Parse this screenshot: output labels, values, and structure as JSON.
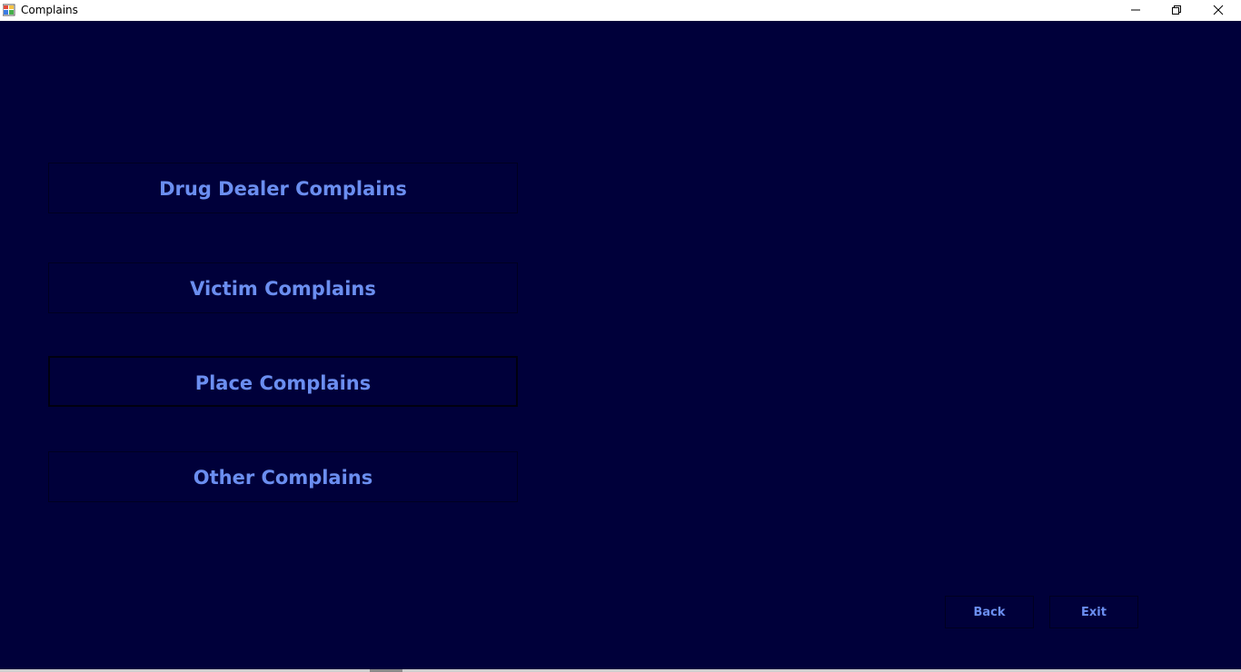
{
  "window": {
    "title": "Complains",
    "app_icon": "winforms-app-icon",
    "controls": {
      "minimize_icon": "minimize-icon",
      "maximize_icon": "restore-icon",
      "close_icon": "close-icon"
    }
  },
  "menu": {
    "drug_dealer_label": "Drug Dealer Complains",
    "victim_label": "Victim Complains",
    "place_label": "Place Complains",
    "other_label": "Other Complains"
  },
  "footer": {
    "back_label": "Back",
    "exit_label": "Exit"
  },
  "colors": {
    "background": "#00003a",
    "button_text": "#6b8ef0",
    "titlebar": "#ffffff"
  }
}
